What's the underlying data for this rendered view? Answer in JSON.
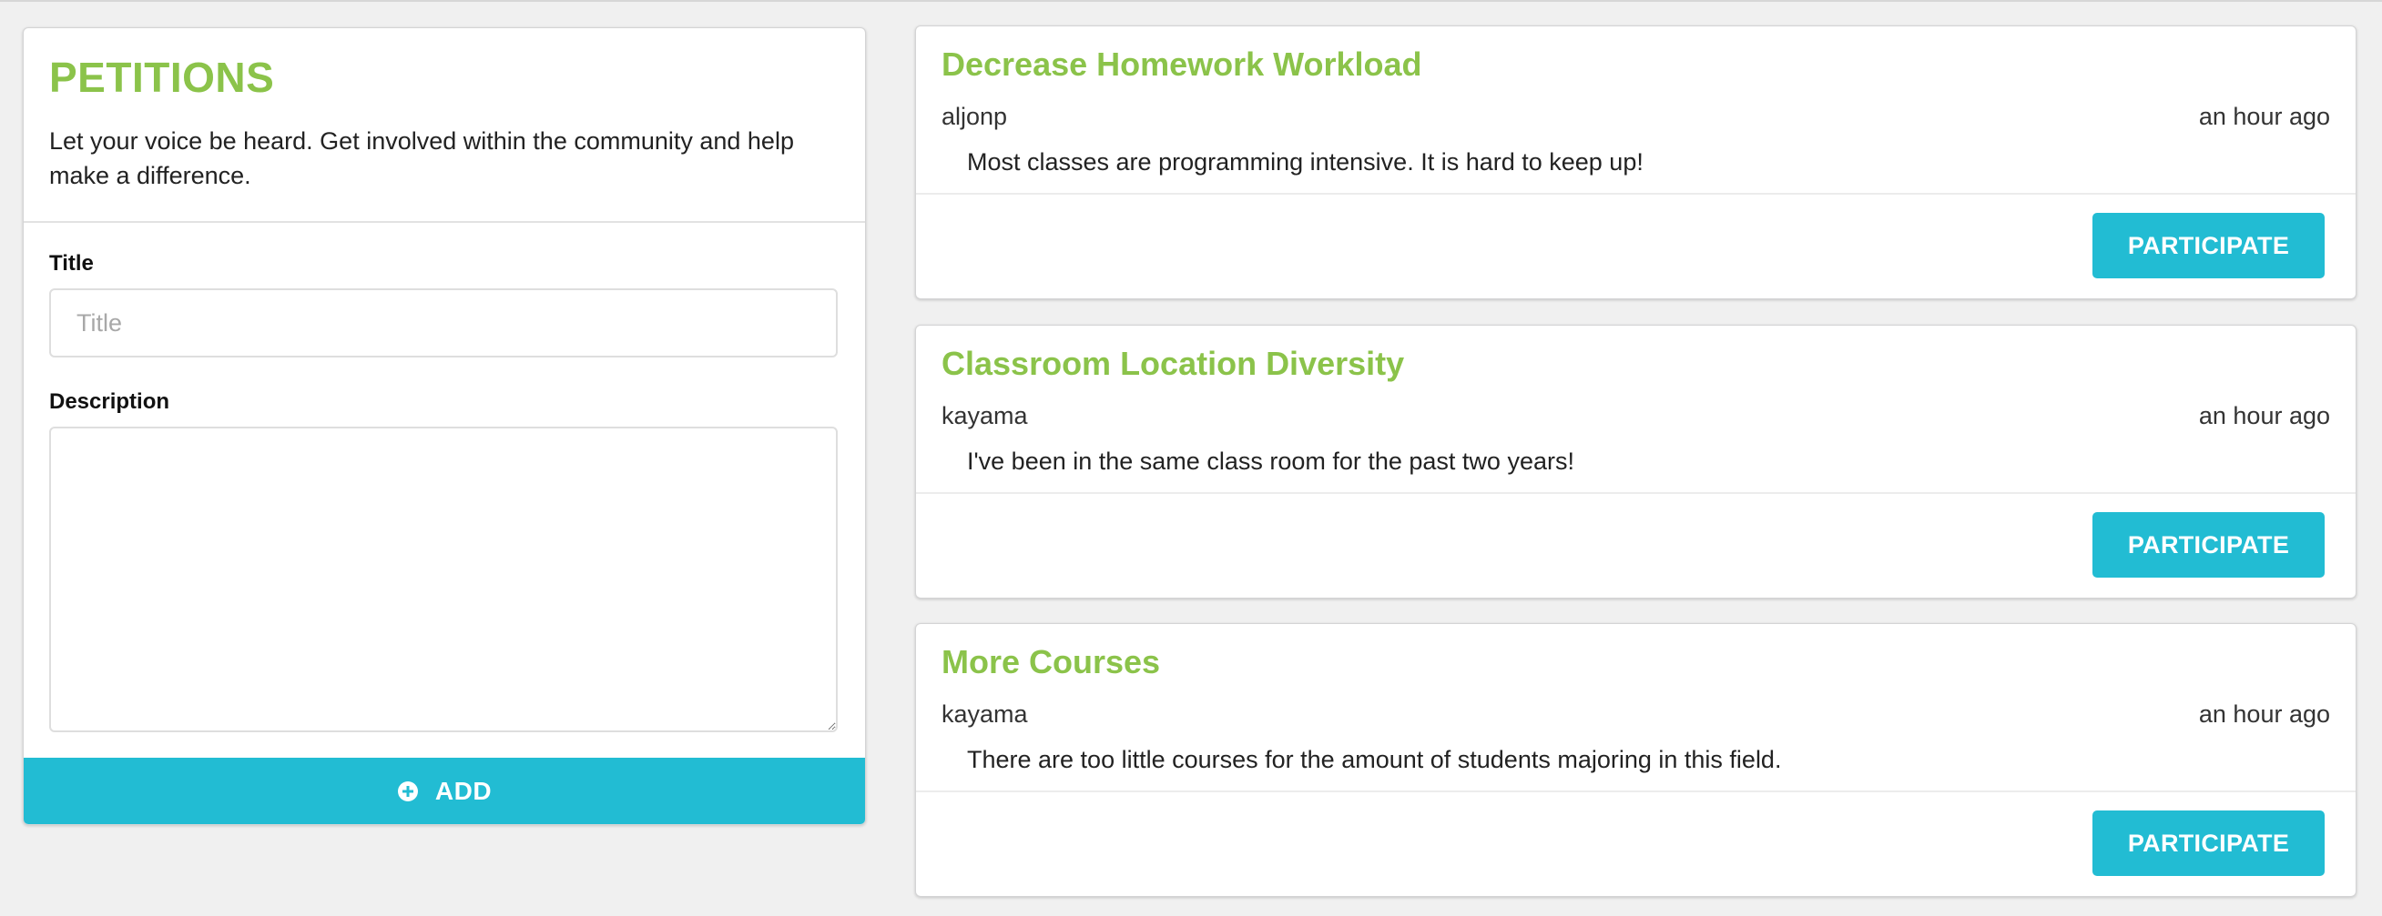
{
  "form": {
    "title": "PETITIONS",
    "subtitle": "Let your voice be heard. Get involved within the community and help make a difference.",
    "title_label": "Title",
    "title_placeholder": "Title",
    "title_value": "",
    "description_label": "Description",
    "description_value": "",
    "add_label": "ADD",
    "add_icon": "plus-circle-icon"
  },
  "colors": {
    "accent_green": "#8bc34a",
    "button_teal": "#22bcd3",
    "background": "#f0f0f0"
  },
  "petitions": [
    {
      "title": "Decrease Homework Workload",
      "author": "aljonp",
      "time": "an hour ago",
      "description": "Most classes are programming intensive. It is hard to keep up!",
      "button_label": "PARTICIPATE"
    },
    {
      "title": "Classroom Location Diversity",
      "author": "kayama",
      "time": "an hour ago",
      "description": "I've been in the same class room for the past two years!",
      "button_label": "PARTICIPATE"
    },
    {
      "title": "More Courses",
      "author": "kayama",
      "time": "an hour ago",
      "description": "There are too little courses for the amount of students majoring in this field.",
      "button_label": "PARTICIPATE"
    }
  ]
}
